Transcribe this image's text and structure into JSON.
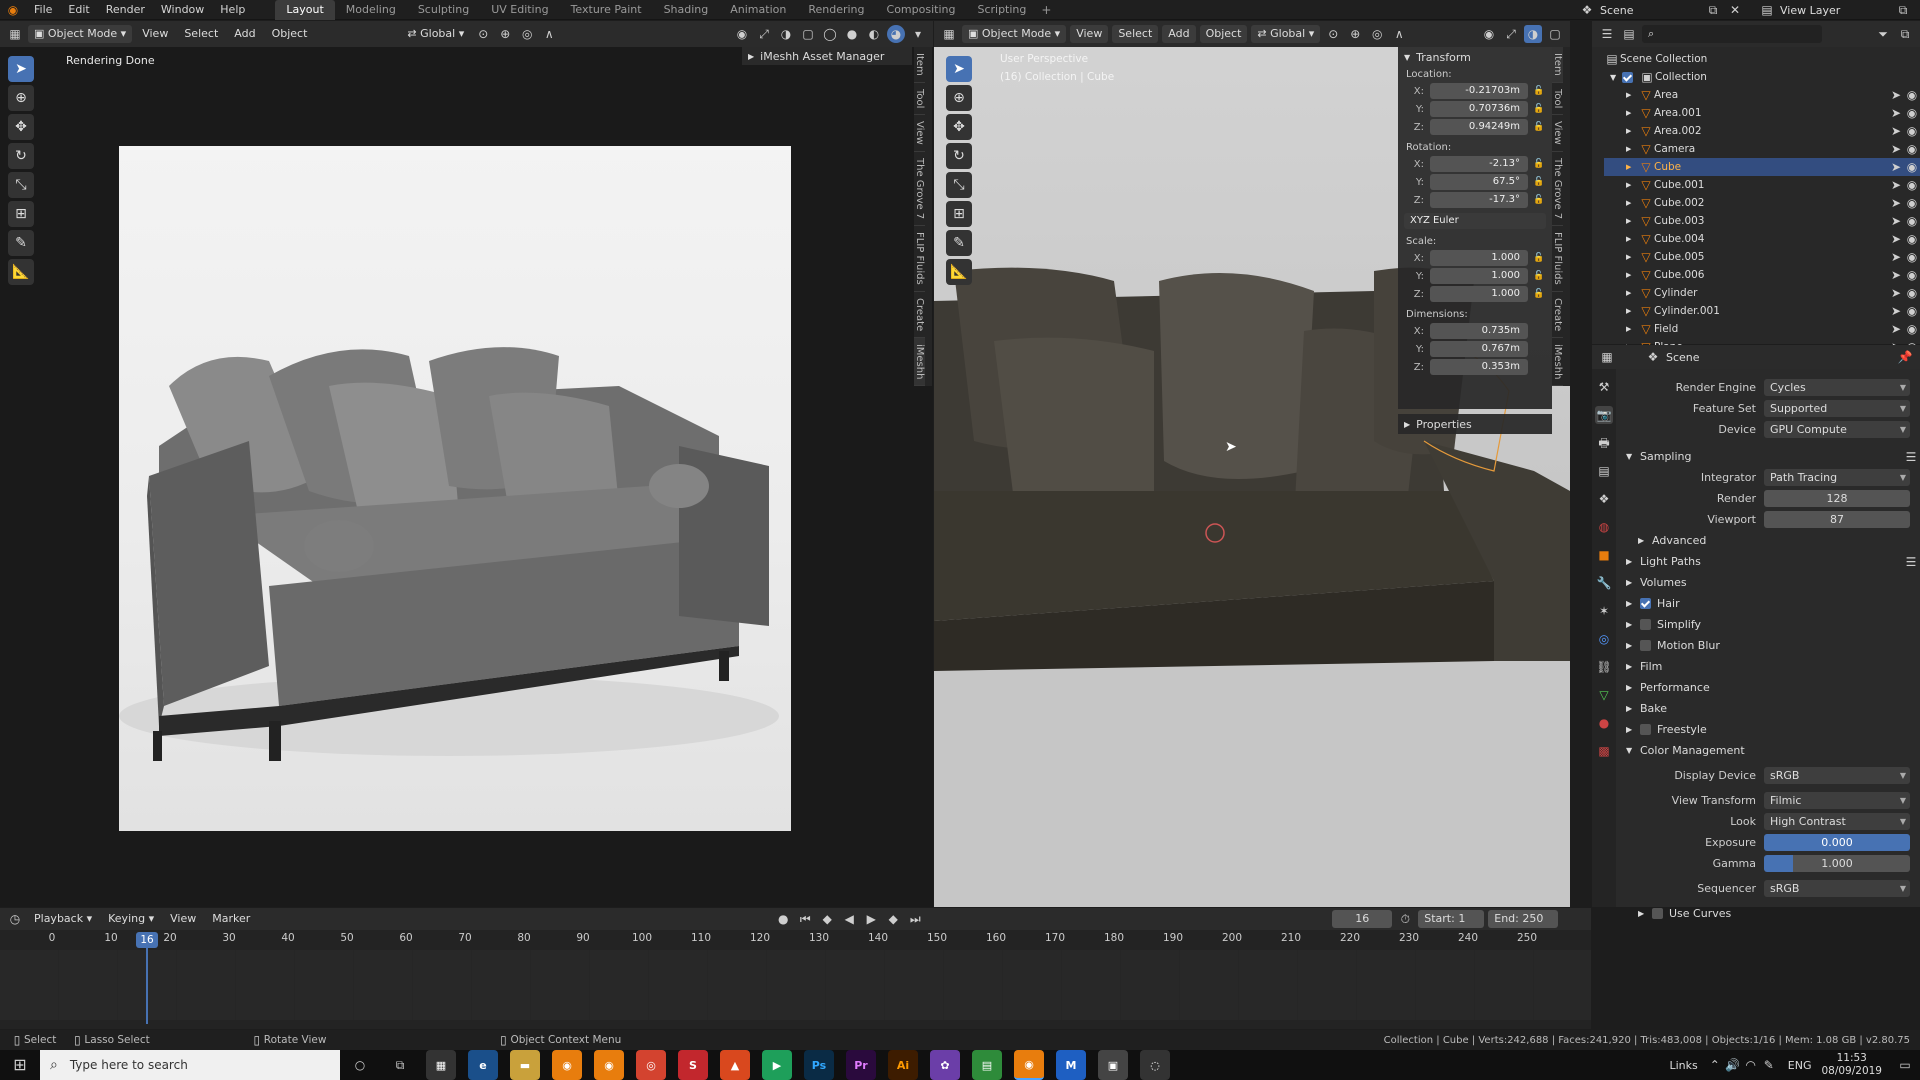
{
  "topbar": {
    "menus": [
      "File",
      "Edit",
      "Render",
      "Window",
      "Help"
    ],
    "workspaces": [
      "Layout",
      "Modeling",
      "Sculpting",
      "UV Editing",
      "Texture Paint",
      "Shading",
      "Animation",
      "Rendering",
      "Compositing",
      "Scripting"
    ],
    "active_workspace": "Layout",
    "scene": "Scene",
    "view_layer": "View Layer"
  },
  "left_editor": {
    "mode": "Object Mode",
    "menus": [
      "View",
      "Select",
      "Add",
      "Object"
    ],
    "transform": "Global",
    "status": "Rendering Done",
    "asset_manager": "iMeshh Asset Manager",
    "vtabs": [
      "Item",
      "Tool",
      "View",
      "The Grove 7",
      "FLIP Fluids",
      "Create",
      "iMeshh"
    ]
  },
  "viewport": {
    "mode": "Object Mode",
    "menus": [
      "View",
      "Select",
      "Add",
      "Object"
    ],
    "transform": "Global",
    "perspective": "User Perspective",
    "collection_info": "(16) Collection | Cube",
    "vtabs": [
      "Item",
      "Tool",
      "View",
      "The Grove 7",
      "FLIP Fluids",
      "Create",
      "iMeshh"
    ]
  },
  "transform_panel": {
    "title": "Transform",
    "location_label": "Location:",
    "location": {
      "x": "-0.21703m",
      "y": "0.70736m",
      "z": "0.94249m"
    },
    "rotation_label": "Rotation:",
    "rotation": {
      "x": "-2.13°",
      "y": "67.5°",
      "z": "-17.3°"
    },
    "rotation_mode": "XYZ Euler",
    "scale_label": "Scale:",
    "scale": {
      "x": "1.000",
      "y": "1.000",
      "z": "1.000"
    },
    "dimensions_label": "Dimensions:",
    "dimensions": {
      "x": "0.735m",
      "y": "0.767m",
      "z": "0.353m"
    },
    "properties": "Properties",
    "axis": {
      "x": "X:",
      "y": "Y:",
      "z": "Z:"
    }
  },
  "outliner": {
    "root": "Scene Collection",
    "collection": "Collection",
    "items": [
      "Area",
      "Area.001",
      "Area.002",
      "Camera",
      "Cube",
      "Cube.001",
      "Cube.002",
      "Cube.003",
      "Cube.004",
      "Cube.005",
      "Cube.006",
      "Cylinder",
      "Cylinder.001",
      "Field",
      "Plane"
    ]
  },
  "properties": {
    "context": "Scene",
    "render_engine_label": "Render Engine",
    "render_engine": "Cycles",
    "feature_set_label": "Feature Set",
    "feature_set": "Supported",
    "device_label": "Device",
    "device": "GPU Compute",
    "sampling": "Sampling",
    "integrator_label": "Integrator",
    "integrator": "Path Tracing",
    "render_label": "Render",
    "render_samples": "128",
    "viewport_label": "Viewport",
    "viewport_samples": "87",
    "advanced": "Advanced",
    "light_paths": "Light Paths",
    "volumes": "Volumes",
    "hair": "Hair",
    "simplify": "Simplify",
    "motion_blur": "Motion Blur",
    "film": "Film",
    "performance": "Performance",
    "bake": "Bake",
    "freestyle": "Freestyle",
    "color_management": "Color Management",
    "display_device_label": "Display Device",
    "display_device": "sRGB",
    "view_transform_label": "View Transform",
    "view_transform": "Filmic",
    "look_label": "Look",
    "look": "High Contrast",
    "exposure_label": "Exposure",
    "exposure": "0.000",
    "gamma_label": "Gamma",
    "gamma": "1.000",
    "sequencer_label": "Sequencer",
    "sequencer": "sRGB",
    "use_curves": "Use Curves"
  },
  "timeline": {
    "menus": [
      "Playback",
      "Keying",
      "View",
      "Marker"
    ],
    "current_frame": "16",
    "start_label": "Start:",
    "start": "1",
    "end_label": "End:",
    "end": "250",
    "ticks": [
      "0",
      "10",
      "20",
      "30",
      "40",
      "50",
      "60",
      "70",
      "80",
      "90",
      "100",
      "110",
      "120",
      "130",
      "140",
      "150",
      "160",
      "170",
      "180",
      "190",
      "200",
      "210",
      "220",
      "230",
      "240",
      "250"
    ]
  },
  "statusbar": {
    "select": "Select",
    "lasso": "Lasso Select",
    "rotate": "Rotate View",
    "context_menu": "Object Context Menu",
    "stats": "Collection | Cube | Verts:242,688 | Faces:241,920 | Tris:483,008 | Objects:1/16 | Mem: 1.08 GB | v2.80.75"
  },
  "taskbar": {
    "search_placeholder": "Type here to search",
    "links": "Links",
    "lang": "ENG",
    "time": "11:53",
    "date": "08/09/2019"
  }
}
